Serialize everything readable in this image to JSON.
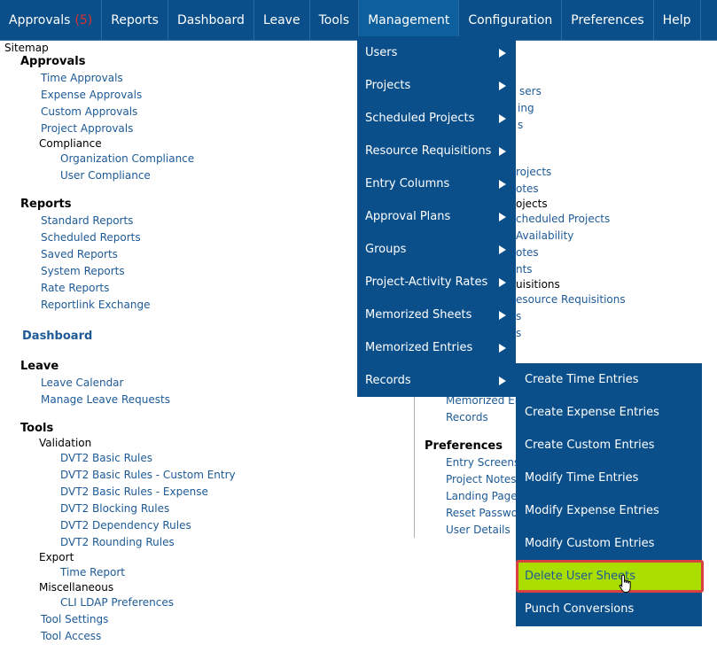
{
  "nav": {
    "approvals": "Approvals",
    "approvals_count": "(5)",
    "reports": "Reports",
    "dashboard": "Dashboard",
    "leave": "Leave",
    "tools": "Tools",
    "management": "Management",
    "configuration": "Configuration",
    "preferences": "Preferences",
    "help": "Help"
  },
  "sitemap": {
    "title": "Sitemap",
    "approvals": {
      "heading": "Approvals",
      "time": "Time Approvals",
      "expense": "Expense Approvals",
      "custom": "Custom Approvals",
      "project": "Project Approvals",
      "compliance": "Compliance",
      "org_compliance": "Organization Compliance",
      "user_compliance": "User Compliance"
    },
    "reports": {
      "heading": "Reports",
      "standard": "Standard Reports",
      "scheduled": "Scheduled Reports",
      "saved": "Saved Reports",
      "system": "System Reports",
      "rate": "Rate Reports",
      "reportlink": "Reportlink Exchange"
    },
    "dashboard": "Dashboard",
    "leave": {
      "heading": "Leave",
      "calendar": "Leave Calendar",
      "manage": "Manage Leave Requests"
    },
    "tools": {
      "heading": "Tools",
      "validation": "Validation",
      "dvt2_basic": "DVT2 Basic Rules",
      "dvt2_custom": "DVT2 Basic Rules - Custom Entry",
      "dvt2_expense": "DVT2 Basic Rules - Expense",
      "dvt2_blocking": "DVT2 Blocking Rules",
      "dvt2_dependency": "DVT2 Dependency Rules",
      "dvt2_rounding": "DVT2 Rounding Rules",
      "export": "Export",
      "time_report": "Time Report",
      "misc": "Miscellaneous",
      "cli_ldap": "CLI LDAP Preferences",
      "tool_settings": "Tool Settings",
      "tool_access": "Tool Access"
    },
    "right": {
      "r1": "sers",
      "r2": "ing",
      "r3": "s",
      "r4": "rojects",
      "r5": "otes",
      "r6": "ojects",
      "r7": "cheduled Projects",
      "r8": "Availability",
      "r9": "otes",
      "r10": "nts",
      "r11": "uisitions",
      "r12": "esource Requisitions",
      "r13": "s",
      "r14": "s",
      "memorized": "Memorized En",
      "records": "Records",
      "preferences": "Preferences",
      "entry_screens": "Entry Screens",
      "project_notes": "Project Notes",
      "landing_page": "Landing Page",
      "reset_password": "Reset Passwo",
      "user_details": "User Details"
    }
  },
  "management_menu": [
    "Users",
    "Projects",
    "Scheduled Projects",
    "Resource Requisitions",
    "Entry Columns",
    "Approval Plans",
    "Groups",
    "Project-Activity Rates",
    "Memorized Sheets",
    "Memorized Entries",
    "Records"
  ],
  "records_menu": [
    "Create Time Entries",
    "Create Expense Entries",
    "Create Custom Entries",
    "Modify Time Entries",
    "Modify Expense Entries",
    "Modify Custom Entries",
    "Delete User Sheets",
    "Punch Conversions"
  ],
  "colors": {
    "nav_bg": "#0a4f8a",
    "link": "#1d5a96",
    "highlight": "#aadd00",
    "highlight_border": "#d94040",
    "badge": "#e03030"
  }
}
